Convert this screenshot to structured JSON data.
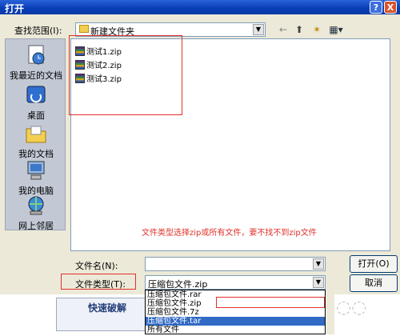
{
  "window": {
    "title": "打开",
    "help": "?",
    "close": "X"
  },
  "lookin": {
    "label": "查找范围(I):",
    "value": "新建文件夹"
  },
  "toolbar": {
    "back": "←",
    "up": "⬆",
    "new_folder": "✶",
    "views": "▦▾"
  },
  "places": [
    {
      "label": "我最近的文档",
      "icon": "recent-documents-icon"
    },
    {
      "label": "桌面",
      "icon": "desktop-icon"
    },
    {
      "label": "我的文档",
      "icon": "my-documents-icon"
    },
    {
      "label": "我的电脑",
      "icon": "my-computer-icon"
    },
    {
      "label": "网上邻居",
      "icon": "network-places-icon"
    }
  ],
  "files": [
    "测试1.zip",
    "测试2.zip",
    "测试3.zip"
  ],
  "annotation": "文件类型选择zip或所有文件，要不找不到zip文件",
  "filename": {
    "label": "文件名(N):",
    "value": ""
  },
  "filetype": {
    "label": "文件类型(T):",
    "value": "压缩包文件.zip"
  },
  "buttons": {
    "open": "打开(O)",
    "cancel": "取消"
  },
  "filetype_options": [
    "压缩包文件.rar",
    "压缩包文件.zip",
    "压缩包文件.7z",
    "压缩包文件.tar",
    "所有文件"
  ],
  "background": {
    "button_text": "快速破解"
  },
  "colors": {
    "annotation": "#e0302a",
    "selection": "#316ac5",
    "titlebar": "#0a3fb8"
  }
}
